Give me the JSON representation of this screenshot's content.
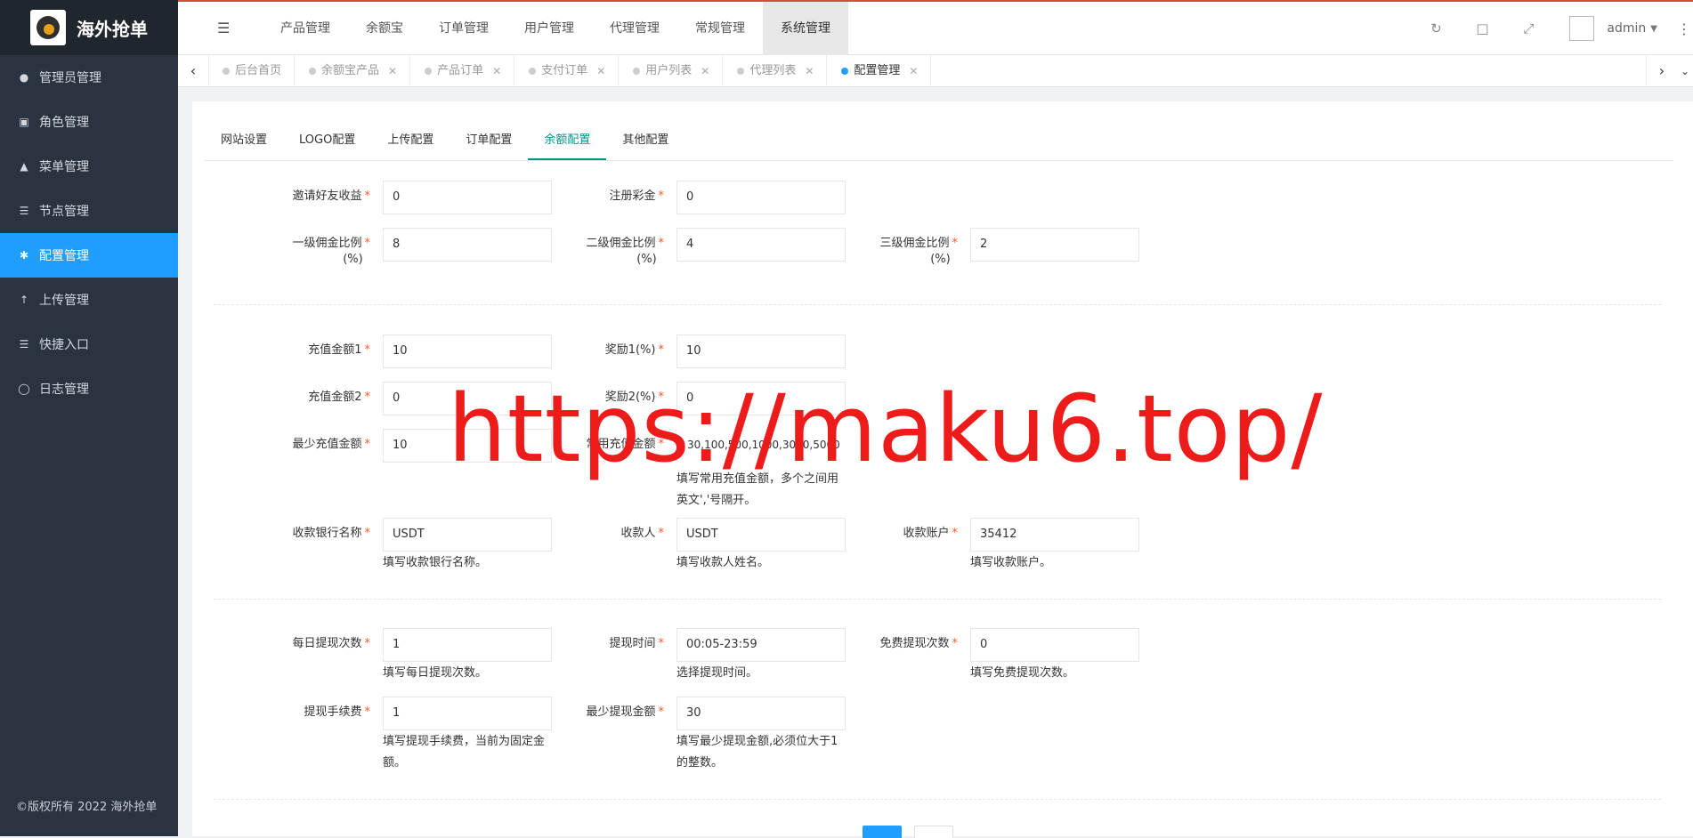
{
  "app": {
    "title": "海外抢单",
    "copyright": "©版权所有 2022 海外抢单"
  },
  "sidebar": {
    "items": [
      {
        "label": "管理员管理",
        "icon": "user-icon"
      },
      {
        "label": "角色管理",
        "icon": "id-card-icon"
      },
      {
        "label": "菜单管理",
        "icon": "tree-icon"
      },
      {
        "label": "节点管理",
        "icon": "list-icon"
      },
      {
        "label": "配置管理",
        "icon": "gear-icon",
        "active": true
      },
      {
        "label": "上传管理",
        "icon": "upload-icon"
      },
      {
        "label": "快捷入口",
        "icon": "list-icon"
      },
      {
        "label": "日志管理",
        "icon": "log-icon"
      }
    ]
  },
  "header": {
    "nav": [
      "产品管理",
      "余额宝",
      "订单管理",
      "用户管理",
      "代理管理",
      "常规管理",
      "系统管理"
    ],
    "active_nav": "系统管理",
    "user": "admin"
  },
  "tabs": [
    {
      "label": "后台首页",
      "closable": false
    },
    {
      "label": "余额宝产品",
      "closable": true
    },
    {
      "label": "产品订单",
      "closable": true
    },
    {
      "label": "支付订单",
      "closable": true
    },
    {
      "label": "用户列表",
      "closable": true
    },
    {
      "label": "代理列表",
      "closable": true
    },
    {
      "label": "配置管理",
      "closable": true,
      "active": true
    }
  ],
  "subtabs": [
    "网站设置",
    "LOGO配置",
    "上传配置",
    "订单配置",
    "余额配置",
    "其他配置"
  ],
  "active_subtab": "余额配置",
  "form": {
    "invite_reward": {
      "label": "邀请好友收益",
      "value": "0"
    },
    "register_bonus": {
      "label": "注册彩金",
      "value": "0"
    },
    "level1": {
      "label": "一级佣金比例",
      "label2": "(%)",
      "value": "8"
    },
    "level2": {
      "label": "二级佣金比例",
      "label2": "(%)",
      "value": "4"
    },
    "level3": {
      "label": "三级佣金比例",
      "label2": "(%)",
      "value": "2"
    },
    "recharge1": {
      "label": "充值金额1",
      "value": "10"
    },
    "reward1": {
      "label": "奖励1(%)",
      "value": "10"
    },
    "recharge2": {
      "label": "充值金额2",
      "value": "0"
    },
    "reward2": {
      "label": "奖励2(%)",
      "value": "0"
    },
    "min_recharge": {
      "label": "最少充值金额",
      "value": "10"
    },
    "common_recharge": {
      "label": "常用充值金额",
      "value": "30,100,500,1000,3000,5000",
      "help": "填写常用充值金额，多个之间用英文','号隔开。"
    },
    "bank_name": {
      "label": "收款银行名称",
      "value": "USDT",
      "help": "填写收款银行名称。"
    },
    "payee": {
      "label": "收款人",
      "value": "USDT",
      "help": "填写收款人姓名。"
    },
    "account": {
      "label": "收款账户",
      "value": "35412",
      "help": "填写收款账户。"
    },
    "daily_withdraw": {
      "label": "每日提现次数",
      "value": "1",
      "help": "填写每日提现次数。"
    },
    "withdraw_time": {
      "label": "提现时间",
      "value": "00:05-23:59",
      "help": "选择提现时间。"
    },
    "free_withdraw": {
      "label": "免费提现次数",
      "value": "0",
      "help": "填写免费提现次数。"
    },
    "withdraw_fee": {
      "label": "提现手续费",
      "value": "1",
      "help": "填写提现手续费，当前为固定金额。"
    },
    "min_withdraw": {
      "label": "最少提现金额",
      "value": "30",
      "help": "填写最少提现金额,必须位大于1的整数。"
    }
  },
  "watermark": "https://maku6.top/",
  "colors": {
    "sidebar": "#2a3340",
    "active": "#1e9fff",
    "tab_active": "#009688",
    "required": "#ff5722"
  }
}
